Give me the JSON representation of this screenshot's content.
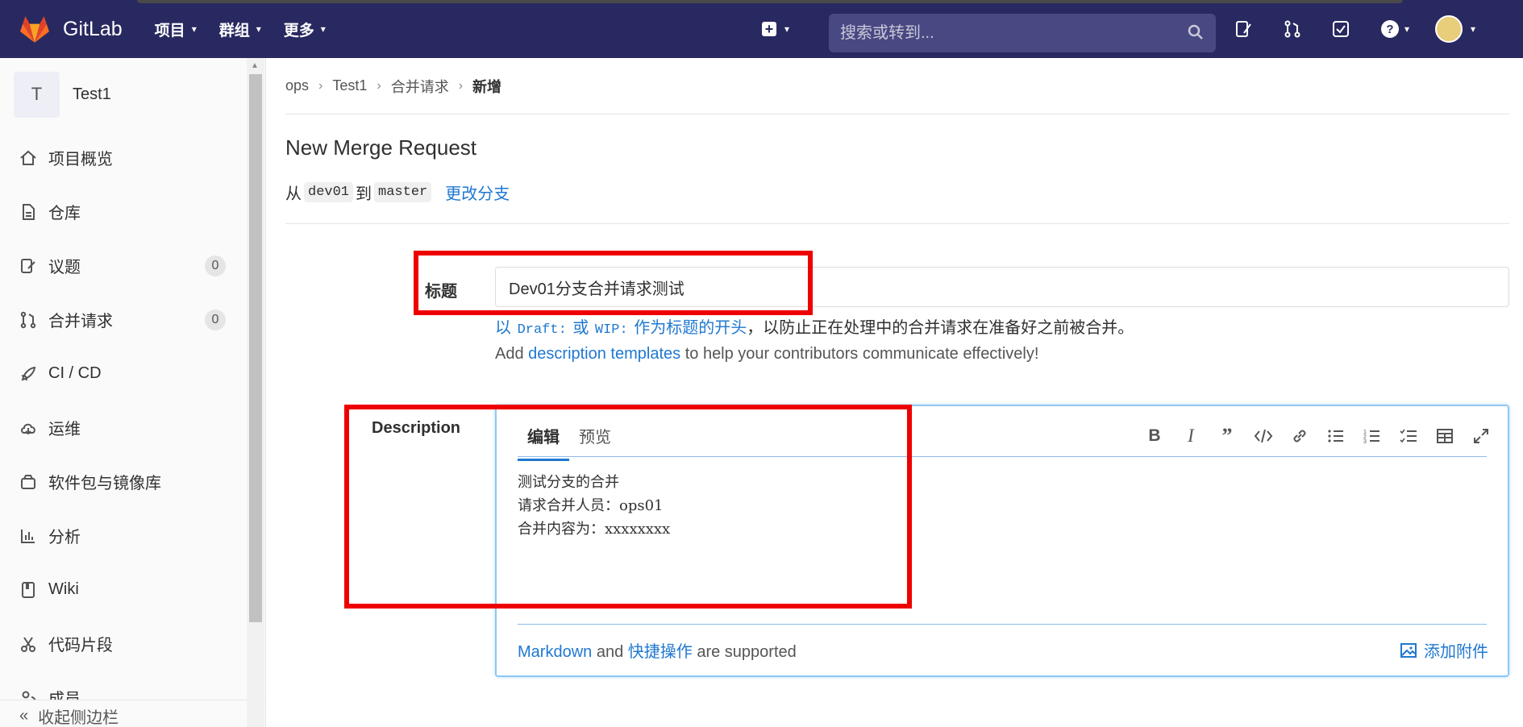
{
  "navbar": {
    "brand": "GitLab",
    "menu": [
      {
        "label": "项目"
      },
      {
        "label": "群组"
      },
      {
        "label": "更多"
      }
    ],
    "search_placeholder": "搜索或转到..."
  },
  "sidebar": {
    "project_initial": "T",
    "project_name": "Test1",
    "items": [
      {
        "label": "项目概览",
        "icon": "home-icon"
      },
      {
        "label": "仓库",
        "icon": "doc-icon"
      },
      {
        "label": "议题",
        "icon": "issues-icon",
        "count": "0"
      },
      {
        "label": "合并请求",
        "icon": "merge-request-icon",
        "count": "0"
      },
      {
        "label": "CI / CD",
        "icon": "rocket-icon"
      },
      {
        "label": "运维",
        "icon": "cloud-icon"
      },
      {
        "label": "软件包与镜像库",
        "icon": "package-icon"
      },
      {
        "label": "分析",
        "icon": "chart-icon"
      },
      {
        "label": "Wiki",
        "icon": "book-icon"
      },
      {
        "label": "代码片段",
        "icon": "scissors-icon"
      },
      {
        "label": "成员",
        "icon": "users-icon"
      }
    ],
    "collapse_label": "收起侧边栏"
  },
  "breadcrumb": [
    "ops",
    "Test1",
    "合并请求",
    "新增"
  ],
  "page": {
    "title": "New Merge Request",
    "from_word": "从",
    "source_branch": "dev01",
    "to_word": "到",
    "target_branch": "master",
    "change_branch": "更改分支"
  },
  "form": {
    "title_label": "标题",
    "title_value": "Dev01分支合并请求测试",
    "wip_hint": {
      "p1": "以",
      "draft": "Draft:",
      "p2": "或",
      "wip": "WIP:",
      "p3": "作为标题的开头",
      "p4": "，以防止正在处理中的合并请求在准备好之前被合并。"
    },
    "templates_hint": {
      "p1": "Add",
      "link": "description templates",
      "p2": "to help your contributors communicate effectively!"
    },
    "description_label": "Description",
    "tabs": [
      "编辑",
      "预览"
    ],
    "description_text": "测试分支的合并\n请求合并人员：ops01\n合并内容为：xxxxxxxx",
    "footer": {
      "markdown": "Markdown",
      "and": "and",
      "shortcuts": "快捷操作",
      "supported": "are supported",
      "attach": "添加附件"
    }
  },
  "colors": {
    "navbar": "#292961",
    "link": "#1f78d1",
    "annotation": "#ee0000"
  }
}
